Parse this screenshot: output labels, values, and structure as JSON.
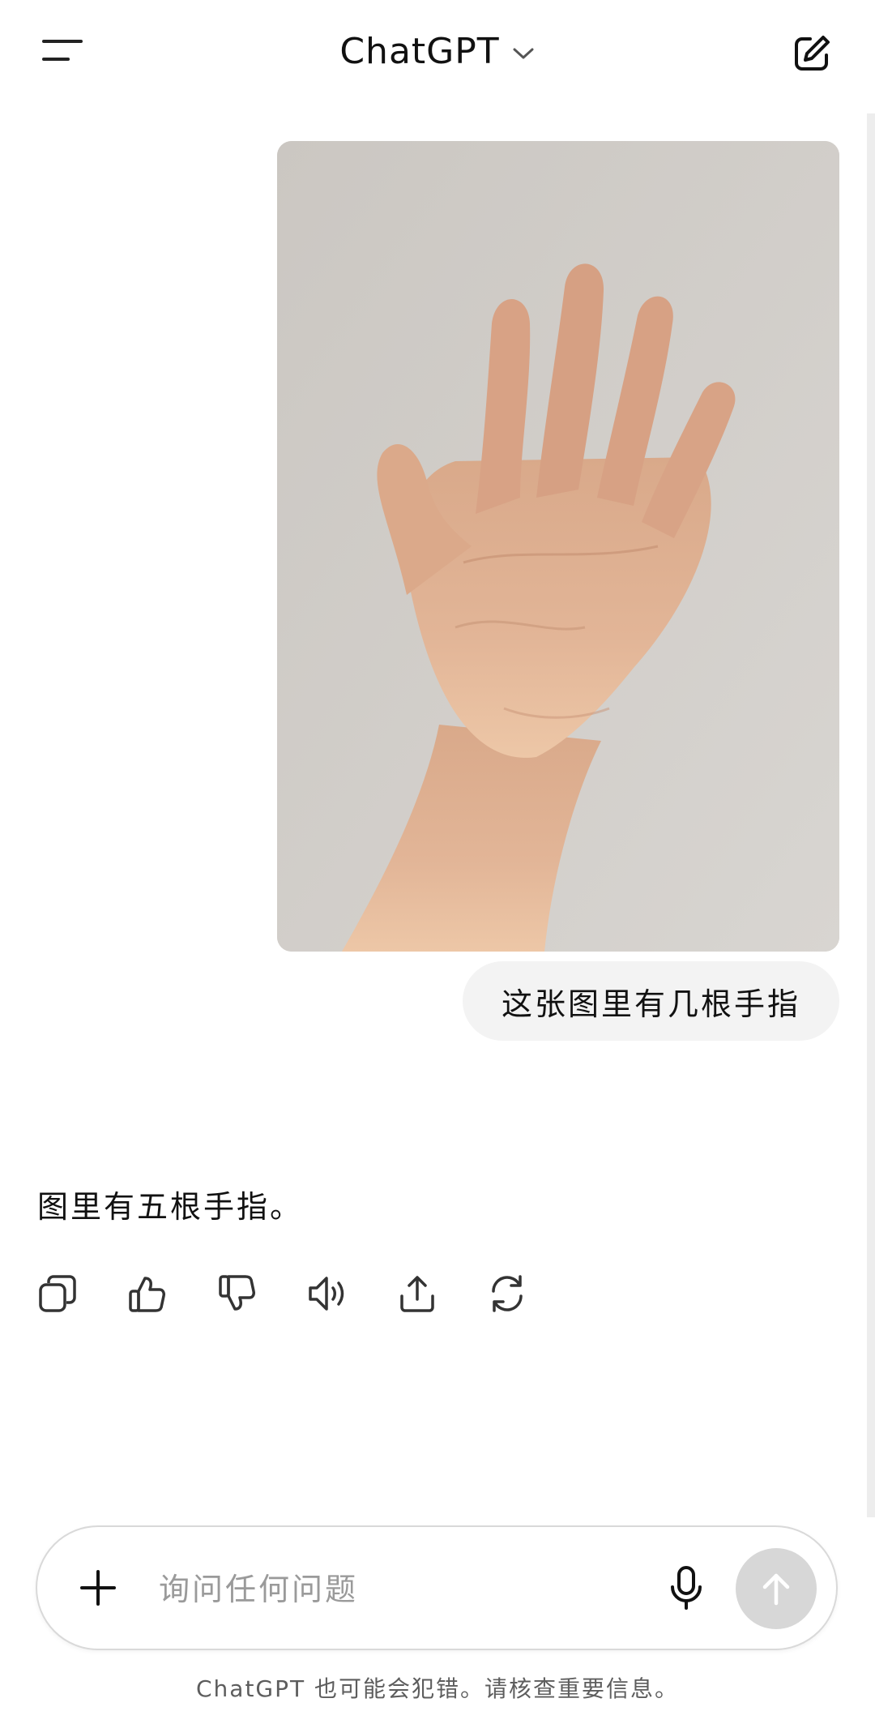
{
  "header": {
    "title": "ChatGPT",
    "menu_icon": "menu-icon",
    "dropdown_icon": "chevron-down-icon",
    "compose_icon": "new-chat-icon"
  },
  "conversation": {
    "user_image_icon": "hand-photo",
    "user_message": "这张图里有几根手指",
    "assistant_message": "图里有五根手指。",
    "actions": [
      {
        "name": "copy-icon"
      },
      {
        "name": "thumbs-up-icon"
      },
      {
        "name": "thumbs-down-icon"
      },
      {
        "name": "read-aloud-icon"
      },
      {
        "name": "share-icon"
      },
      {
        "name": "regenerate-icon"
      }
    ]
  },
  "composer": {
    "placeholder": "询问任何问题",
    "value": "",
    "plus_icon": "plus-icon",
    "mic_icon": "microphone-icon",
    "send_icon": "arrow-up-icon"
  },
  "footer": {
    "disclaimer": "ChatGPT 也可能会犯错。请核查重要信息。"
  },
  "colors": {
    "background": "#ffffff",
    "bubble": "#f3f3f3",
    "send_disabled": "#d7d7d7",
    "text": "#0d0d0d",
    "muted": "#5d5d5d"
  }
}
